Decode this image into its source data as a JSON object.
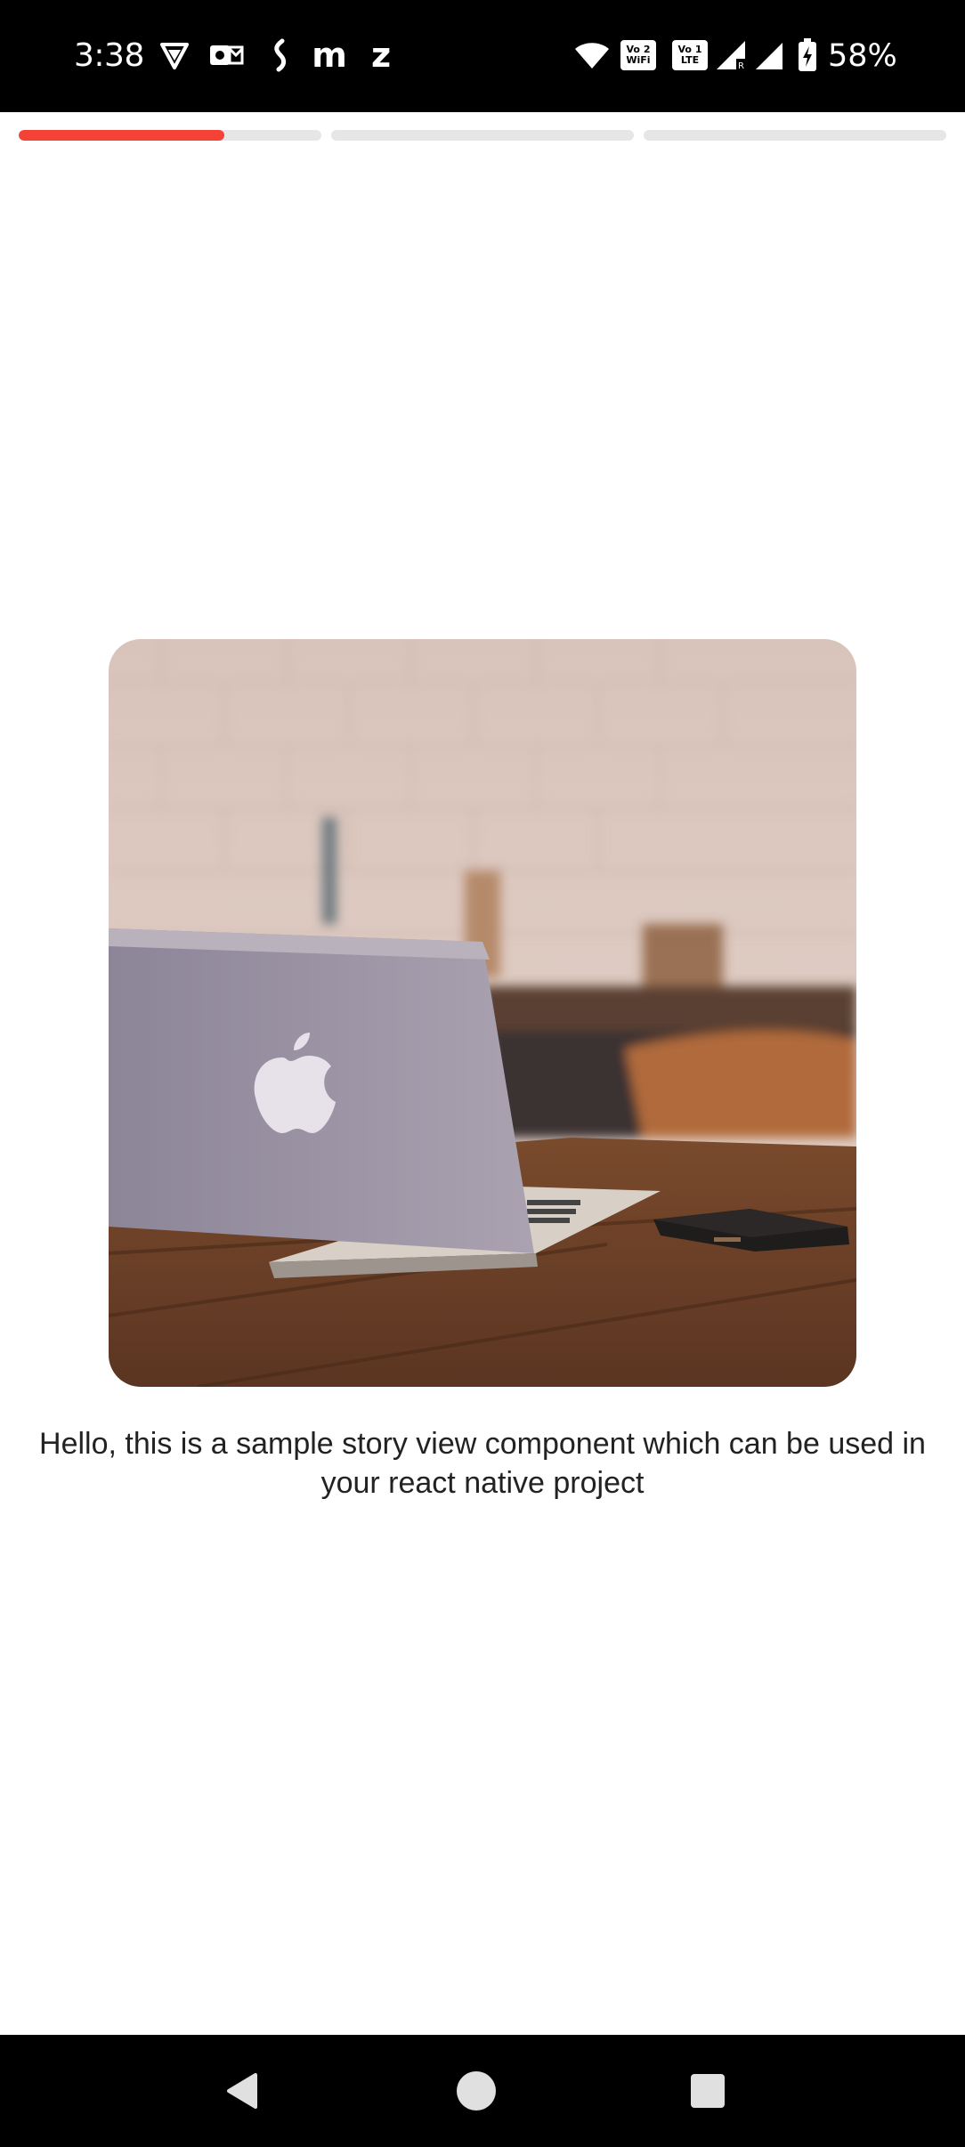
{
  "status_bar": {
    "time": "3:38",
    "left_icons": [
      "vpn-shield-icon",
      "outlook-icon",
      "kotak-icon",
      "m-app-icon",
      "z-app-icon"
    ],
    "m_letter": "m",
    "z_letter": "z",
    "vo_wifi": [
      "Vo",
      "2",
      "WiFi"
    ],
    "vo_lte": [
      "Vo",
      "1",
      "LTE"
    ],
    "battery_percent": "58%"
  },
  "story_progress": {
    "segments": [
      {
        "name": "segment-1",
        "progress": 0.68
      },
      {
        "name": "segment-2",
        "progress": 0
      },
      {
        "name": "segment-3",
        "progress": 0
      }
    ],
    "active_color": "#f44336",
    "track_color": "#e6e6e6"
  },
  "story": {
    "image_icon": "laptop-on-desk-photo",
    "caption": "Hello, this is a sample story view component which can be used in your react native project"
  },
  "nav_bar": {
    "icons": [
      "back-triangle-icon",
      "home-circle-icon",
      "recents-square-icon"
    ]
  }
}
